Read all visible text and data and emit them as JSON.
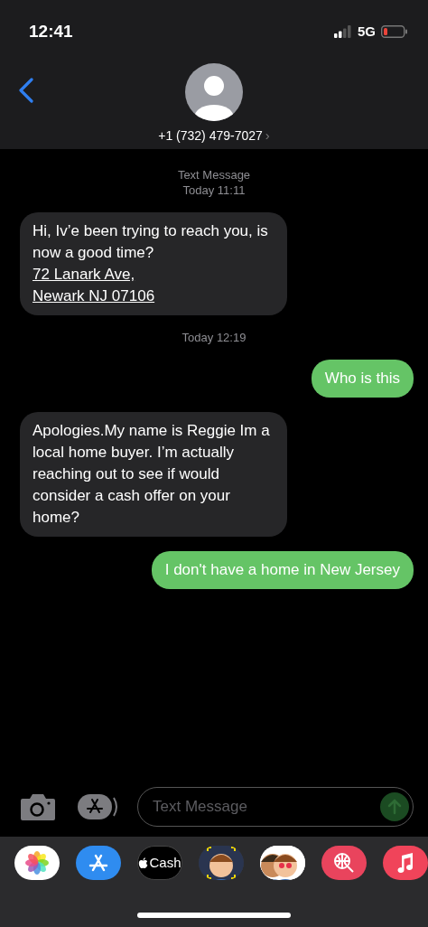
{
  "status_bar": {
    "time": "12:41",
    "network": "5G"
  },
  "header": {
    "contact": "+1 (732) 479-7027",
    "chevron": "›"
  },
  "messages": [
    {
      "kind": "timestamp",
      "lines": [
        "Text Message",
        "Today 11:11"
      ]
    },
    {
      "kind": "received",
      "text": "Hi, Iv’e been trying to reach you, is now a good time?",
      "links": [
        "72 Lanark Ave,",
        "Newark NJ 07106"
      ]
    },
    {
      "kind": "timestamp",
      "lines": [
        "Today 12:19"
      ]
    },
    {
      "kind": "sent",
      "text": "Who is this"
    },
    {
      "kind": "received",
      "text": "Apologies.My name is Reggie Im a local home buyer. I’m actually reaching out to see if would consider a cash offer on your home?"
    },
    {
      "kind": "sent",
      "text": "I don't have a home in New Jersey"
    }
  ],
  "composer": {
    "placeholder": "Text Message"
  },
  "app_drawer": [
    {
      "kind": "photos"
    },
    {
      "kind": "appstore"
    },
    {
      "kind": "cash",
      "label": "Cash"
    },
    {
      "kind": "memoji"
    },
    {
      "kind": "stickers"
    },
    {
      "kind": "search"
    },
    {
      "kind": "music"
    }
  ]
}
